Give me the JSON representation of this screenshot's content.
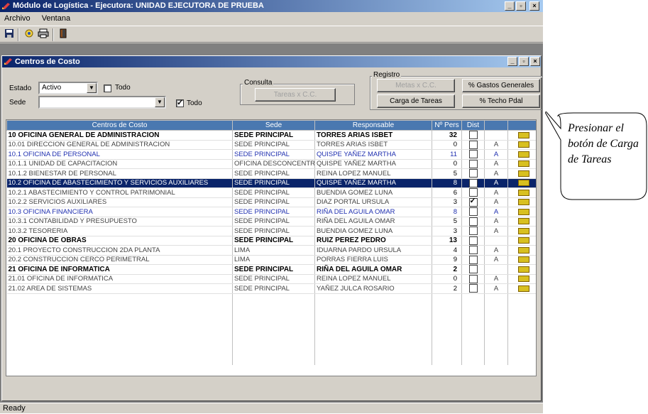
{
  "window": {
    "title": "Módulo de Logística - Ejecutora: UNIDAD EJECUTORA DE PRUEBA",
    "min": "_",
    "max": "▫",
    "close": "×"
  },
  "menu": [
    "Archivo",
    "Ventana"
  ],
  "child": {
    "title": "Centros de Costo",
    "min": "_",
    "max": "▫",
    "close": "×"
  },
  "filters": {
    "estado_label": "Estado",
    "estado_value": "Activo",
    "todo_estado_label": "Todo",
    "todo_estado_checked": false,
    "sede_label": "Sede",
    "sede_value": "",
    "todo_sede_label": "Todo",
    "todo_sede_checked": true
  },
  "consulta": {
    "label": "Consulta",
    "tareas_button": "Tareas x C.C."
  },
  "registro": {
    "label": "Registro",
    "metas_button": "Metas x C.C.",
    "gastos_button": "% Gastos Generales",
    "carga_button": "Carga de Tareas",
    "techo_button": "% Techo Pdal"
  },
  "grid": {
    "columns": [
      "Centros de Costo",
      "Sede",
      "Responsable",
      "Nº Pers",
      "Dist",
      "",
      ""
    ],
    "rows": [
      {
        "cc": "10 OFICINA GENERAL DE ADMINISTRACION",
        "sede": "SEDE PRINCIPAL",
        "resp": "TORRES ARIAS ISBET",
        "pers": "32",
        "chk": false,
        "x": "",
        "style": "bold"
      },
      {
        "cc": "10.01 DIRECCION GENERAL DE ADMINISTRACION",
        "sede": "SEDE PRINCIPAL",
        "resp": "TORRES ARIAS ISBET",
        "pers": "0",
        "chk": false,
        "x": "A",
        "style": ""
      },
      {
        "cc": "10.1 OFICINA DE PERSONAL",
        "sede": "SEDE PRINCIPAL",
        "resp": "QUISPE YAÑEZ MARTHA",
        "pers": "11",
        "chk": false,
        "x": "A",
        "style": "blue"
      },
      {
        "cc": "10.1.1 UNIDAD DE CAPACITACION",
        "sede": "OFICINA DESCONCENTRADA",
        "resp": "QUISPE YAÑEZ MARTHA",
        "pers": "0",
        "chk": false,
        "x": "A",
        "style": ""
      },
      {
        "cc": "10.1.2 BIENESTAR DE PERSONAL",
        "sede": "SEDE PRINCIPAL",
        "resp": "REINA LOPEZ MANUEL",
        "pers": "5",
        "chk": false,
        "x": "A",
        "style": ""
      },
      {
        "cc": "10.2 OFICINA DE ABASTECIMIENTO Y SERVICIOS AUXILIARES",
        "sede": "SEDE PRINCIPAL",
        "resp": "QUISPE YAÑEZ MARTHA",
        "pers": "8",
        "chk": false,
        "x": "A",
        "style": "sel"
      },
      {
        "cc": "10.2.1 ABASTECIMIENTO Y CONTROL PATRIMONIAL",
        "sede": "SEDE PRINCIPAL",
        "resp": "BUENDIA GOMEZ LUNA",
        "pers": "6",
        "chk": false,
        "x": "A",
        "style": ""
      },
      {
        "cc": "10.2.2 SERVICIOS AUXILIARES",
        "sede": "SEDE PRINCIPAL",
        "resp": "DIAZ PORTAL URSULA",
        "pers": "3",
        "chk": true,
        "x": "A",
        "style": ""
      },
      {
        "cc": "10.3 OFICINA FINANCIERA",
        "sede": "SEDE PRINCIPAL",
        "resp": "RIÑA DEL AGUILA OMAR",
        "pers": "8",
        "chk": false,
        "x": "A",
        "style": "blue"
      },
      {
        "cc": "10.3.1 CONTABILIDAD Y PRESUPUESTO",
        "sede": "SEDE PRINCIPAL",
        "resp": "RIÑA DEL AGUILA OMAR",
        "pers": "5",
        "chk": false,
        "x": "A",
        "style": ""
      },
      {
        "cc": "10.3.2 TESORERIA",
        "sede": "SEDE PRINCIPAL",
        "resp": "BUENDIA GOMEZ LUNA",
        "pers": "3",
        "chk": false,
        "x": "A",
        "style": ""
      },
      {
        "cc": "20 OFICINA DE OBRAS",
        "sede": "SEDE PRINCIPAL",
        "resp": "RUIZ PEREZ PEDRO",
        "pers": "13",
        "chk": false,
        "x": "",
        "style": "bold"
      },
      {
        "cc": "20.1 PROYECTO CONSTRUCCION 2DA PLANTA",
        "sede": "LIMA",
        "resp": "IDUARNA PARDO URSULA",
        "pers": "4",
        "chk": false,
        "x": "A",
        "style": ""
      },
      {
        "cc": "20.2 CONSTRUCCION CERCO PERIMETRAL",
        "sede": "LIMA",
        "resp": "PORRAS FIERRA LUIS",
        "pers": "9",
        "chk": false,
        "x": "A",
        "style": ""
      },
      {
        "cc": "21 OFICINA DE INFORMATICA",
        "sede": "SEDE PRINCIPAL",
        "resp": "RIÑA DEL AGUILA OMAR",
        "pers": "2",
        "chk": false,
        "x": "",
        "style": "bold"
      },
      {
        "cc": "21.01 OFICINA DE INFORMATICA",
        "sede": "SEDE PRINCIPAL",
        "resp": "REINA LOPEZ MANUEL",
        "pers": "0",
        "chk": false,
        "x": "A",
        "style": ""
      },
      {
        "cc": "21.02 AREA DE SISTEMAS",
        "sede": "SEDE PRINCIPAL",
        "resp": "YAÑEZ JULCA ROSARIO",
        "pers": "2",
        "chk": false,
        "x": "A",
        "style": ""
      }
    ]
  },
  "status": "Ready",
  "callout": "Presionar el botón de Carga de Tareas"
}
